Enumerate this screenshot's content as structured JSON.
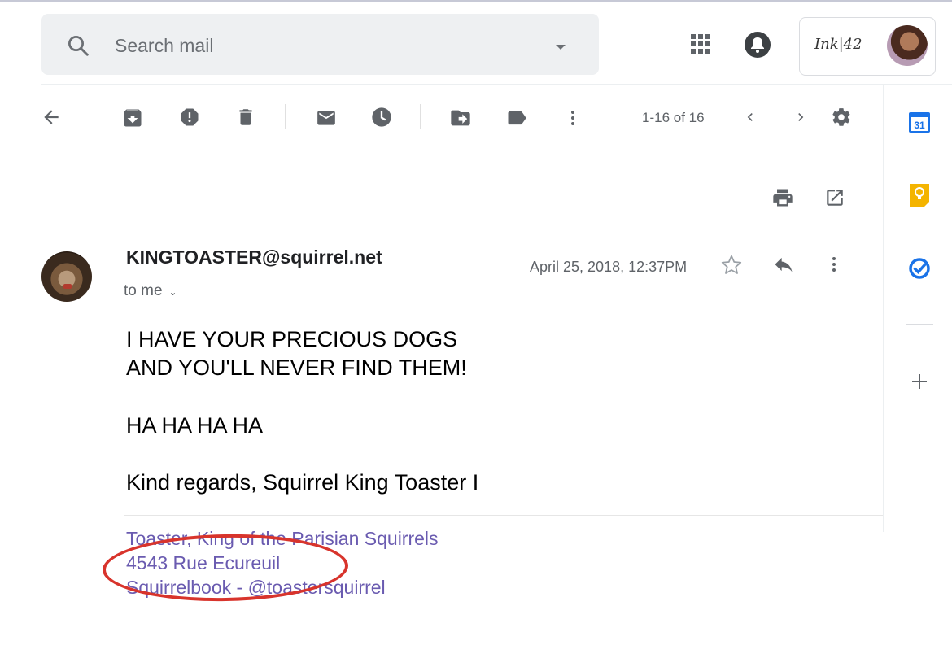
{
  "search": {
    "placeholder": "Search mail"
  },
  "account": {
    "brand": "Ink|42"
  },
  "toolbar": {
    "pager": "1-16 of 16"
  },
  "side_panel": {
    "calendar_day": "31"
  },
  "message": {
    "sender": "KINGTOASTER@squirrel.net",
    "recipient": "to me",
    "date": "April 25, 2018, 12:37PM",
    "body_lines": [
      "I HAVE YOUR PRECIOUS DOGS",
      "AND YOU'LL NEVER FIND THEM!",
      "HA HA HA HA",
      "Kind regards, Squirrel King Toaster I"
    ],
    "signature_lines": [
      "Toaster, King of the Parisian Squirrels",
      "4543 Rue Ecureuil",
      "Squirrelbook - @toastersquirrel"
    ]
  },
  "colors": {
    "accent_blue": "#1a73e8",
    "keep_yellow": "#f4b400",
    "signature_link": "#6a5bb0",
    "annotation_red": "#d8342c",
    "icon_gray": "#5f6368"
  }
}
